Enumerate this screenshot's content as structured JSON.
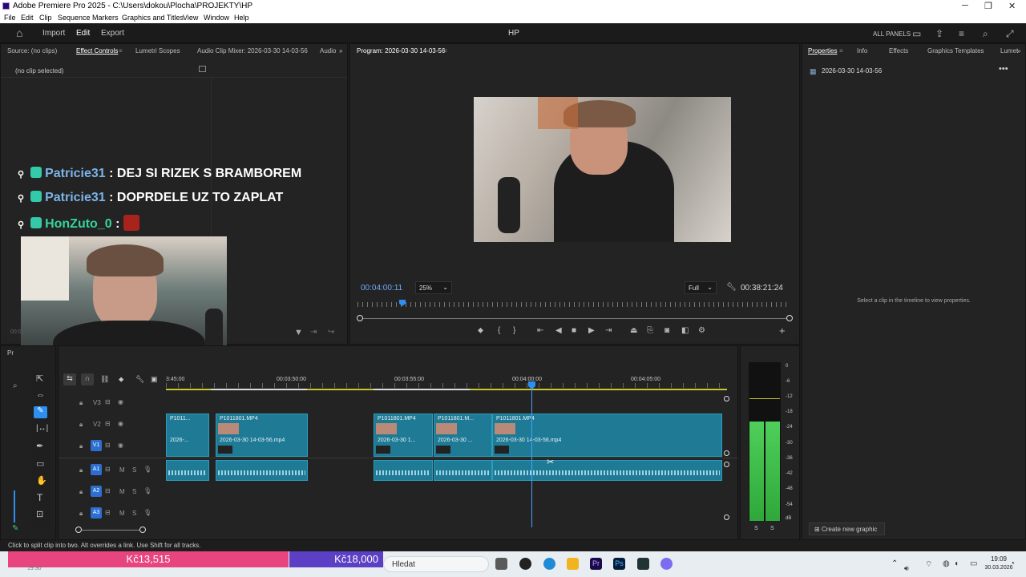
{
  "window": {
    "title": "Adobe Premiere Pro 2025 - C:\\Users\\dokou\\Plocha\\PROJEKTY\\HP"
  },
  "menu": [
    "File",
    "Edit",
    "Clip",
    "Sequence",
    "Markers",
    "Graphics and Titles",
    "View",
    "Window",
    "Help"
  ],
  "header": {
    "import": "Import",
    "edit": "Edit",
    "export": "Export",
    "project": "HP",
    "all_panels": "ALL PANELS"
  },
  "source_panel": {
    "tabs": [
      "Source: (no clips)",
      "Effect Controls",
      "Lumetri Scopes",
      "Audio Clip Mixer: 2026-03-30 14-03-56",
      "Audio"
    ],
    "no_clip": "(no clip selected)",
    "tc_left": "00:0"
  },
  "chat": [
    {
      "user": "Patricie31",
      "sep": ":",
      "msg": "DEJ SI RIZEK S BRAMBOREM"
    },
    {
      "user": "Patricie31",
      "sep": ":",
      "msg": "DOPRDELE UZ TO ZAPLAT"
    },
    {
      "user": "HonZuto_0",
      "sep": ":",
      "msg": ""
    }
  ],
  "program_panel": {
    "tab": "Program: 2026-03-30 14-03-56",
    "timecode": "00:04:00:11",
    "zoom": "25%",
    "resolution": "Full",
    "duration": "00:38:21:24"
  },
  "properties_panel": {
    "tabs": [
      "Properties",
      "Info",
      "Effects",
      "Graphics Templates",
      "Lumet"
    ],
    "sequence": "2026-03-30 14-03-56",
    "hint": "Select a clip in the timeline to view properties.",
    "create_graphic": "Create new graphic"
  },
  "timeline": {
    "ruler": [
      "3:45:00",
      "00:03:50:00",
      "00:03:55:00",
      "00:04:00:00",
      "00:04:05:00"
    ],
    "video_tracks": [
      "V3",
      "V2",
      "V1"
    ],
    "audio_tracks": [
      "A1",
      "A2",
      "A3"
    ],
    "clip_name": "P1011801.MP4",
    "clip_short": "P1011...",
    "clip_mid": "P1011801.M...",
    "seq_name": "2026-03-30 14-03-56.mp4",
    "seq_short": "2026-...",
    "seq_mid1": "2026-03-30 1...",
    "seq_mid2": "2026-03-30 ...",
    "seq_full": "2026-03-30 14-03-56.mp4"
  },
  "meter": {
    "scale": [
      "0",
      "-6",
      "-12",
      "-18",
      "-24",
      "-30",
      "-36",
      "-42",
      "-48",
      "-54",
      "dB"
    ],
    "solo": "S"
  },
  "status": "Click to split clip into two. Alt overrides a link. Use Shift for all tracks.",
  "taskbar": {
    "donation1": "Kč13,515",
    "donation2": "Kč18,000",
    "search": "Hledat",
    "time": "19:09",
    "date": "30.03.2026",
    "left_time": "19:30"
  },
  "colors": {
    "accent": "#2d8ff0",
    "clip": "#1e7a95",
    "donation_pink": "#e8457f",
    "donation_purple": "#5b3fc4"
  }
}
